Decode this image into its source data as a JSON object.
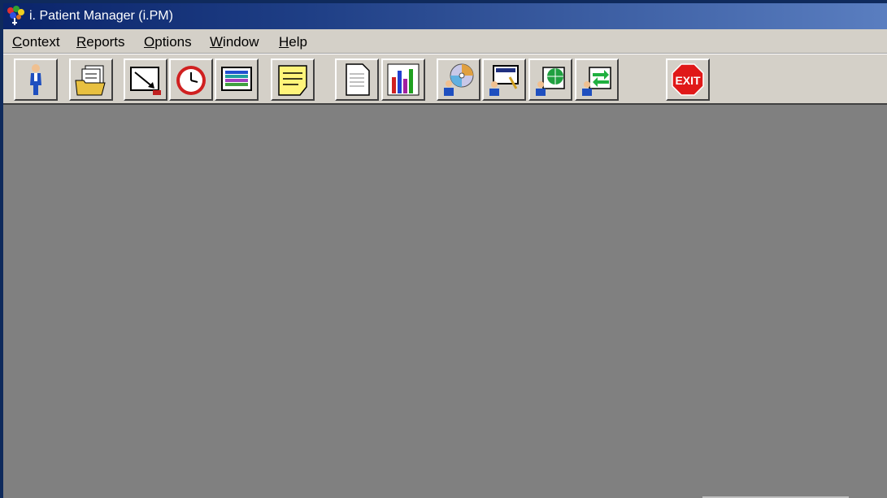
{
  "window": {
    "title": "i. Patient Manager (i.PM)"
  },
  "menu": [
    "Context",
    "Reports",
    "Options",
    "Window",
    "Help"
  ],
  "toolbar": {
    "buttons": [
      {
        "name": "person-icon"
      },
      {
        "name": "folder-documents-icon"
      },
      {
        "name": "slate-arrow-icon"
      },
      {
        "name": "clock-icon"
      },
      {
        "name": "color-list-icon"
      },
      {
        "name": "sticky-note-icon"
      },
      {
        "name": "document-icon"
      },
      {
        "name": "bar-chart-icon"
      },
      {
        "name": "cd-person-icon"
      },
      {
        "name": "screen-person-icon"
      },
      {
        "name": "globe-person-icon"
      },
      {
        "name": "transfer-person-icon"
      },
      {
        "name": "exit-sign-icon",
        "label": "EXIT"
      }
    ]
  },
  "colors": {
    "title_start": "#0a246a",
    "title_end": "#5a7ec0",
    "chrome": "#d4d0c8",
    "workspace": "#808080",
    "exit": "#e01818"
  }
}
